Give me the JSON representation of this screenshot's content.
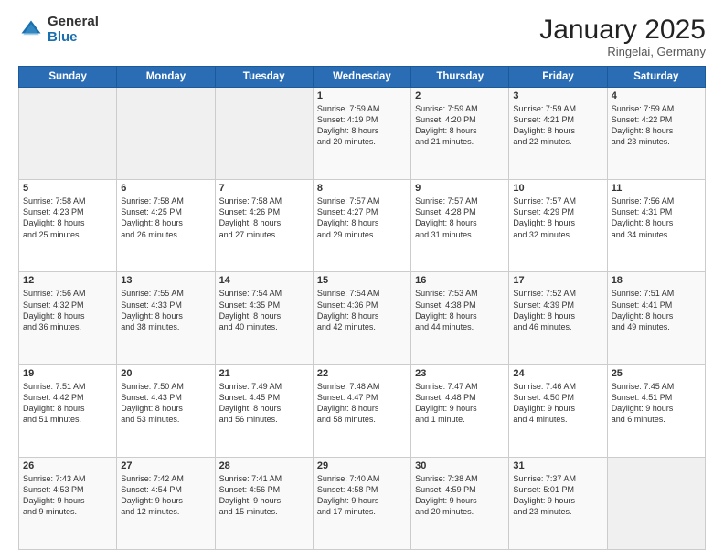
{
  "header": {
    "logo_general": "General",
    "logo_blue": "Blue",
    "month_title": "January 2025",
    "location": "Ringelai, Germany"
  },
  "weekdays": [
    "Sunday",
    "Monday",
    "Tuesday",
    "Wednesday",
    "Thursday",
    "Friday",
    "Saturday"
  ],
  "weeks": [
    [
      {
        "day": "",
        "text": ""
      },
      {
        "day": "",
        "text": ""
      },
      {
        "day": "",
        "text": ""
      },
      {
        "day": "1",
        "text": "Sunrise: 7:59 AM\nSunset: 4:19 PM\nDaylight: 8 hours\nand 20 minutes."
      },
      {
        "day": "2",
        "text": "Sunrise: 7:59 AM\nSunset: 4:20 PM\nDaylight: 8 hours\nand 21 minutes."
      },
      {
        "day": "3",
        "text": "Sunrise: 7:59 AM\nSunset: 4:21 PM\nDaylight: 8 hours\nand 22 minutes."
      },
      {
        "day": "4",
        "text": "Sunrise: 7:59 AM\nSunset: 4:22 PM\nDaylight: 8 hours\nand 23 minutes."
      }
    ],
    [
      {
        "day": "5",
        "text": "Sunrise: 7:58 AM\nSunset: 4:23 PM\nDaylight: 8 hours\nand 25 minutes."
      },
      {
        "day": "6",
        "text": "Sunrise: 7:58 AM\nSunset: 4:25 PM\nDaylight: 8 hours\nand 26 minutes."
      },
      {
        "day": "7",
        "text": "Sunrise: 7:58 AM\nSunset: 4:26 PM\nDaylight: 8 hours\nand 27 minutes."
      },
      {
        "day": "8",
        "text": "Sunrise: 7:57 AM\nSunset: 4:27 PM\nDaylight: 8 hours\nand 29 minutes."
      },
      {
        "day": "9",
        "text": "Sunrise: 7:57 AM\nSunset: 4:28 PM\nDaylight: 8 hours\nand 31 minutes."
      },
      {
        "day": "10",
        "text": "Sunrise: 7:57 AM\nSunset: 4:29 PM\nDaylight: 8 hours\nand 32 minutes."
      },
      {
        "day": "11",
        "text": "Sunrise: 7:56 AM\nSunset: 4:31 PM\nDaylight: 8 hours\nand 34 minutes."
      }
    ],
    [
      {
        "day": "12",
        "text": "Sunrise: 7:56 AM\nSunset: 4:32 PM\nDaylight: 8 hours\nand 36 minutes."
      },
      {
        "day": "13",
        "text": "Sunrise: 7:55 AM\nSunset: 4:33 PM\nDaylight: 8 hours\nand 38 minutes."
      },
      {
        "day": "14",
        "text": "Sunrise: 7:54 AM\nSunset: 4:35 PM\nDaylight: 8 hours\nand 40 minutes."
      },
      {
        "day": "15",
        "text": "Sunrise: 7:54 AM\nSunset: 4:36 PM\nDaylight: 8 hours\nand 42 minutes."
      },
      {
        "day": "16",
        "text": "Sunrise: 7:53 AM\nSunset: 4:38 PM\nDaylight: 8 hours\nand 44 minutes."
      },
      {
        "day": "17",
        "text": "Sunrise: 7:52 AM\nSunset: 4:39 PM\nDaylight: 8 hours\nand 46 minutes."
      },
      {
        "day": "18",
        "text": "Sunrise: 7:51 AM\nSunset: 4:41 PM\nDaylight: 8 hours\nand 49 minutes."
      }
    ],
    [
      {
        "day": "19",
        "text": "Sunrise: 7:51 AM\nSunset: 4:42 PM\nDaylight: 8 hours\nand 51 minutes."
      },
      {
        "day": "20",
        "text": "Sunrise: 7:50 AM\nSunset: 4:43 PM\nDaylight: 8 hours\nand 53 minutes."
      },
      {
        "day": "21",
        "text": "Sunrise: 7:49 AM\nSunset: 4:45 PM\nDaylight: 8 hours\nand 56 minutes."
      },
      {
        "day": "22",
        "text": "Sunrise: 7:48 AM\nSunset: 4:47 PM\nDaylight: 8 hours\nand 58 minutes."
      },
      {
        "day": "23",
        "text": "Sunrise: 7:47 AM\nSunset: 4:48 PM\nDaylight: 9 hours\nand 1 minute."
      },
      {
        "day": "24",
        "text": "Sunrise: 7:46 AM\nSunset: 4:50 PM\nDaylight: 9 hours\nand 4 minutes."
      },
      {
        "day": "25",
        "text": "Sunrise: 7:45 AM\nSunset: 4:51 PM\nDaylight: 9 hours\nand 6 minutes."
      }
    ],
    [
      {
        "day": "26",
        "text": "Sunrise: 7:43 AM\nSunset: 4:53 PM\nDaylight: 9 hours\nand 9 minutes."
      },
      {
        "day": "27",
        "text": "Sunrise: 7:42 AM\nSunset: 4:54 PM\nDaylight: 9 hours\nand 12 minutes."
      },
      {
        "day": "28",
        "text": "Sunrise: 7:41 AM\nSunset: 4:56 PM\nDaylight: 9 hours\nand 15 minutes."
      },
      {
        "day": "29",
        "text": "Sunrise: 7:40 AM\nSunset: 4:58 PM\nDaylight: 9 hours\nand 17 minutes."
      },
      {
        "day": "30",
        "text": "Sunrise: 7:38 AM\nSunset: 4:59 PM\nDaylight: 9 hours\nand 20 minutes."
      },
      {
        "day": "31",
        "text": "Sunrise: 7:37 AM\nSunset: 5:01 PM\nDaylight: 9 hours\nand 23 minutes."
      },
      {
        "day": "",
        "text": ""
      }
    ]
  ]
}
